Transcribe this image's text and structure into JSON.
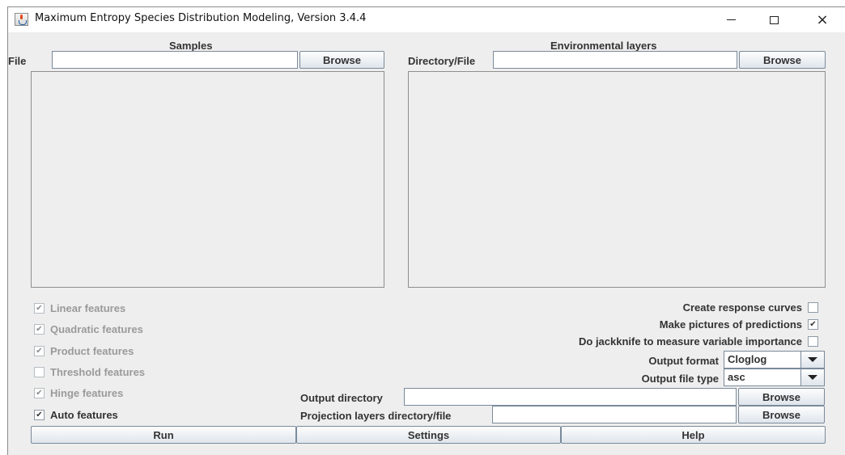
{
  "window": {
    "title": "Maximum Entropy Species Distribution Modeling, Version 3.4.4",
    "controls": {
      "minimize": "minimize-icon",
      "maximize": "maximize-icon",
      "close": "×"
    }
  },
  "samples": {
    "heading": "Samples",
    "file_label": "File",
    "file_value": "",
    "browse_label": "Browse"
  },
  "environment": {
    "heading": "Environmental layers",
    "dir_label": "Directory/File",
    "dir_value": "",
    "browse_label": "Browse"
  },
  "features": [
    {
      "label": "Linear features",
      "checked": true,
      "enabled": false
    },
    {
      "label": "Quadratic features",
      "checked": true,
      "enabled": false
    },
    {
      "label": "Product features",
      "checked": true,
      "enabled": false
    },
    {
      "label": "Threshold features",
      "checked": false,
      "enabled": false
    },
    {
      "label": "Hinge features",
      "checked": true,
      "enabled": false
    },
    {
      "label": "Auto features",
      "checked": true,
      "enabled": true
    }
  ],
  "options": {
    "response_curves": {
      "label": "Create response curves",
      "checked": false
    },
    "pictures": {
      "label": "Make pictures of predictions",
      "checked": true
    },
    "jackknife": {
      "label": "Do jackknife to measure variable importance",
      "checked": false
    },
    "output_format": {
      "label": "Output format",
      "value": "Cloglog"
    },
    "output_file_type": {
      "label": "Output file type",
      "value": "asc"
    }
  },
  "output_directory": {
    "label": "Output directory",
    "value": "",
    "browse_label": "Browse"
  },
  "projection_layers": {
    "label": "Projection layers directory/file",
    "value": "",
    "browse_label": "Browse"
  },
  "bottom_buttons": {
    "run": "Run",
    "settings": "Settings",
    "help": "Help"
  },
  "check_glyph": "✔"
}
